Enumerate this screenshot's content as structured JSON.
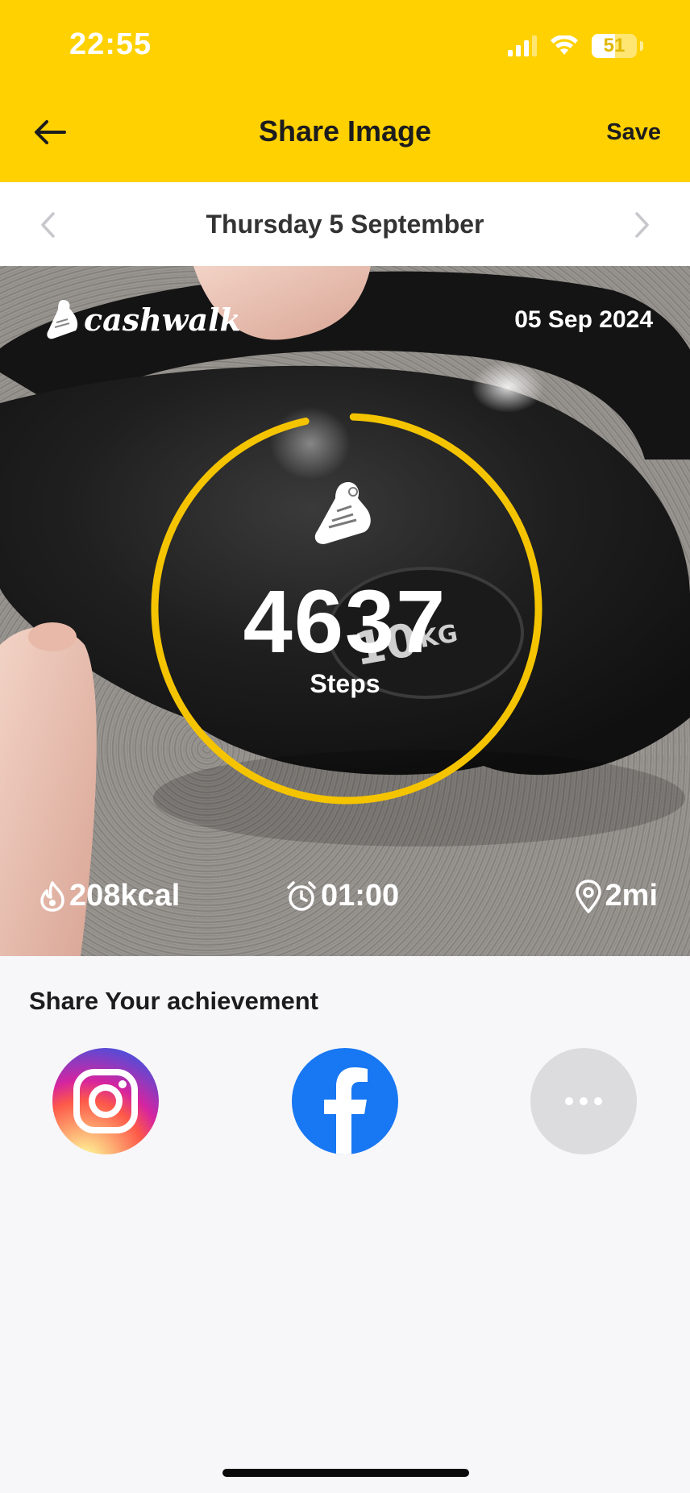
{
  "status_bar": {
    "time": "22:55",
    "battery_percent": 51,
    "battery_label": "51"
  },
  "nav": {
    "title": "Share Image",
    "save_label": "Save",
    "back_icon": "arrow-left-icon"
  },
  "date_bar": {
    "label": "Thursday 5 September",
    "prev_icon": "chevron-left-icon",
    "next_icon": "chevron-right-icon"
  },
  "card": {
    "brand": "cashwalk",
    "date": "05 Sep 2024",
    "steps_value": "4637",
    "steps_label": "Steps",
    "ring_progress": 0.96,
    "kcal": "208kcal",
    "duration": "01:00",
    "distance": "2mi"
  },
  "share": {
    "title": "Share Your achievement",
    "options": [
      "instagram",
      "facebook",
      "more"
    ]
  },
  "colors": {
    "accent": "#ffd100",
    "ring": "#f5c400",
    "facebook": "#1877f2",
    "background": "#f7f7f9"
  }
}
